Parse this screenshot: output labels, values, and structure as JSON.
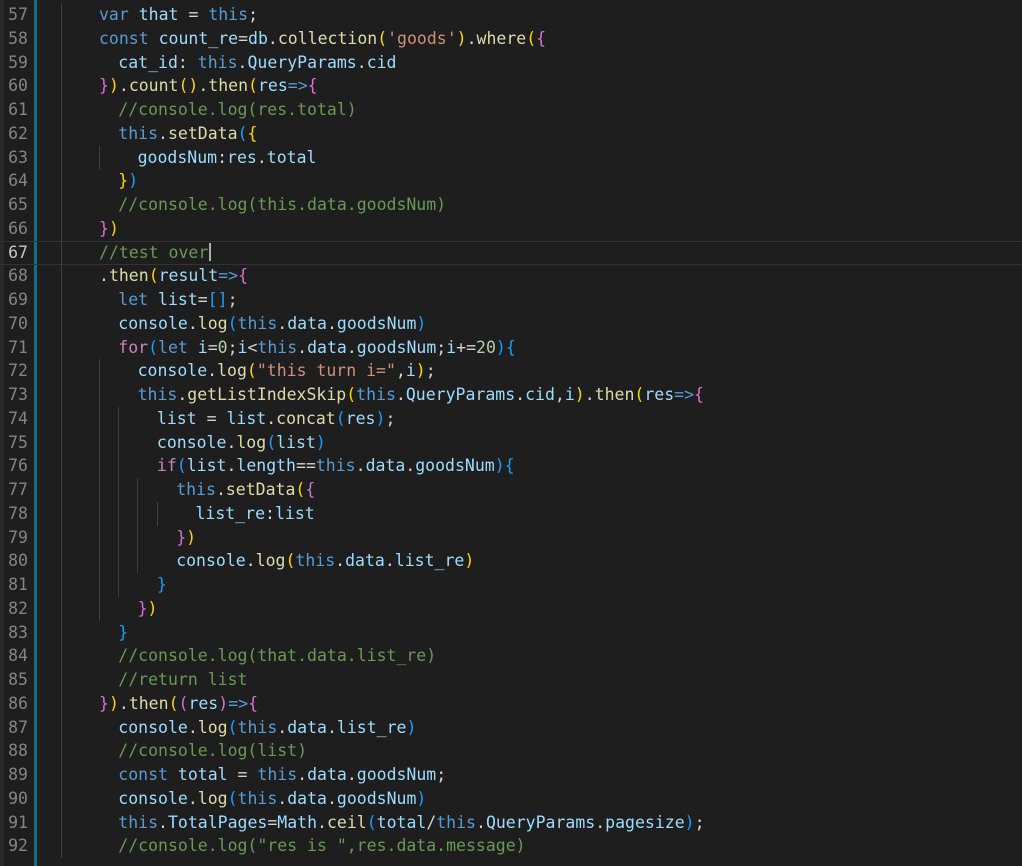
{
  "editor": {
    "cursor_line": "67",
    "lines": [
      {
        "num": "57",
        "text": "var that = this;"
      },
      {
        "num": "58",
        "text": "const count_re=db.collection('goods').where({"
      },
      {
        "num": "59",
        "text": "cat_id: this.QueryParams.cid"
      },
      {
        "num": "60",
        "text": "}).count().then(res=>{"
      },
      {
        "num": "61",
        "text": "//console.log(res.total)"
      },
      {
        "num": "62",
        "text": "this.setData({"
      },
      {
        "num": "63",
        "text": "goodsNum:res.total"
      },
      {
        "num": "64",
        "text": "})"
      },
      {
        "num": "65",
        "text": "//console.log(this.data.goodsNum)"
      },
      {
        "num": "66",
        "text": "})"
      },
      {
        "num": "67",
        "text": "//test over"
      },
      {
        "num": "68",
        "text": ".then(result=>{"
      },
      {
        "num": "69",
        "text": "let list=[];"
      },
      {
        "num": "70",
        "text": "console.log(this.data.goodsNum)"
      },
      {
        "num": "71",
        "text": "for(let i=0;i<this.data.goodsNum;i+=20){"
      },
      {
        "num": "72",
        "text": "console.log(\"this turn i=\",i);"
      },
      {
        "num": "73",
        "text": "this.getListIndexSkip(this.QueryParams.cid,i).then(res=>{"
      },
      {
        "num": "74",
        "text": "list = list.concat(res);"
      },
      {
        "num": "75",
        "text": "console.log(list)"
      },
      {
        "num": "76",
        "text": "if(list.length==this.data.goodsNum){"
      },
      {
        "num": "77",
        "text": "this.setData({"
      },
      {
        "num": "78",
        "text": "list_re:list"
      },
      {
        "num": "79",
        "text": "})"
      },
      {
        "num": "80",
        "text": "console.log(this.data.list_re)"
      },
      {
        "num": "81",
        "text": "}"
      },
      {
        "num": "82",
        "text": "})"
      },
      {
        "num": "83",
        "text": "}"
      },
      {
        "num": "84",
        "text": "//console.log(that.data.list_re)"
      },
      {
        "num": "85",
        "text": "//return list"
      },
      {
        "num": "86",
        "text": "}).then((res)=>{"
      },
      {
        "num": "87",
        "text": "console.log(this.data.list_re)"
      },
      {
        "num": "88",
        "text": "//console.log(list)"
      },
      {
        "num": "89",
        "text": "const total = this.data.goodsNum;"
      },
      {
        "num": "90",
        "text": "console.log(this.data.goodsNum)"
      },
      {
        "num": "91",
        "text": "this.TotalPages=Math.ceil(total/this.QueryParams.pagesize);"
      },
      {
        "num": "92",
        "text": "//console.log(\"res is \",res.data.message)"
      }
    ]
  },
  "colors": {
    "background": "#1e1e1e",
    "keyword": "#569cd6",
    "control": "#c586c0",
    "variable": "#9cdcfe",
    "function": "#dcdcaa",
    "string": "#ce9178",
    "number": "#b5cea8",
    "comment": "#6a9955",
    "bracket_1": "#ffd700",
    "bracket_2": "#da70d6",
    "bracket_3": "#179fff",
    "gutter_accent": "#0b6e8f"
  }
}
